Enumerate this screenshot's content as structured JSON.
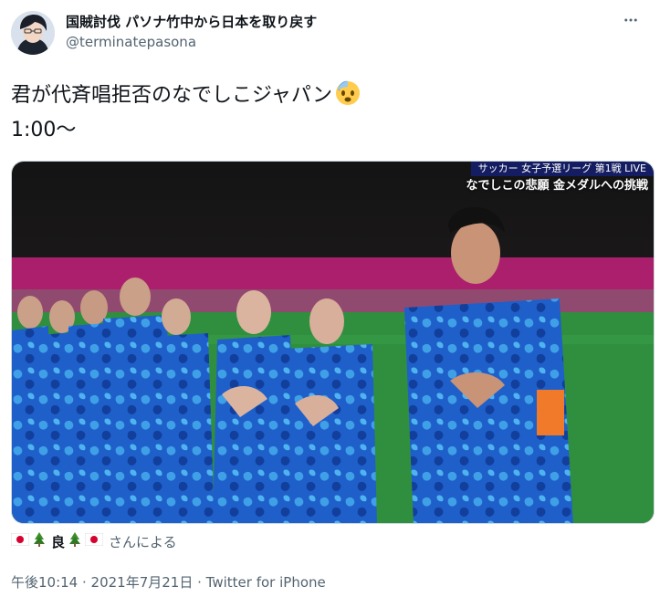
{
  "author": {
    "display_name": "国賊討伐 パソナ竹中から日本を取り戻す",
    "handle": "@terminatepasona"
  },
  "tweet": {
    "lines": [
      "君が代斉唱拒否のなでしこジャパン",
      "1:00〜"
    ],
    "emoji": "anxious-face-with-sweat"
  },
  "media": {
    "alt": "",
    "banner_text": "サッカー 女子予選リーグ 第1戦 LIVE",
    "caption_text": "なでしこの悲願 金メダルへの挑戦"
  },
  "tagged": {
    "mid_label": "良",
    "suffix": "さんによる"
  },
  "timestamp": {
    "time": "午後10:14",
    "separator": " · ",
    "date": "2021年7月21日",
    "source": "Twitter for iPhone"
  },
  "colors": {
    "text_primary": "#0f1419",
    "text_secondary": "#536471",
    "border": "#cfd9de",
    "jersey": "#1f5fc9",
    "pitch": "#2f8f3e"
  },
  "icons": [
    "avatar",
    "more-icon",
    "japan-flag-icon",
    "pine-decoration-icon",
    "anxious-face-icon"
  ]
}
